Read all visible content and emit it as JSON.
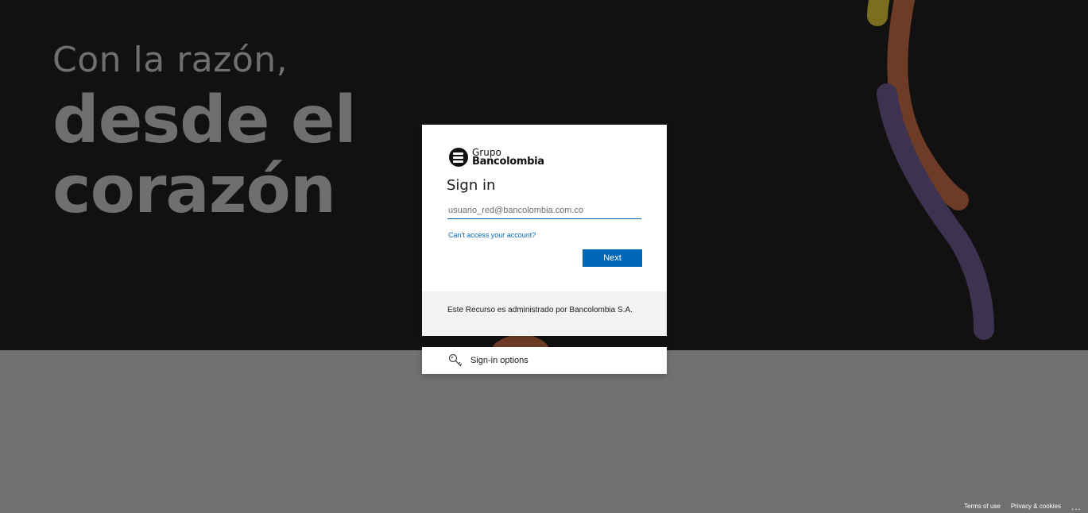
{
  "background": {
    "tagline_line1": "Con la razón,",
    "tagline_line2": "desde el",
    "tagline_line3": "corazón"
  },
  "card": {
    "logo_line1": "Grupo",
    "logo_line2": "Bancolombia",
    "title": "Sign in",
    "email_placeholder": "usuario_red@bancolombia.com.co",
    "cant_access_link": "Can't access your account?",
    "next_button": "Next",
    "footer_text": "Este Recurso es administrado por Bancolombia S.A."
  },
  "sign_in_options": {
    "icon": "key-icon",
    "label": "Sign-in options"
  },
  "footer": {
    "terms": "Terms of use",
    "privacy": "Privacy & cookies",
    "more": "..."
  },
  "colors": {
    "accent": "#0067b8",
    "hero_bg": "#111111",
    "page_bg": "#707070",
    "tagline": "#6f6f6f",
    "decor_olive": "#7b6e1e",
    "decor_brown": "#6e3b27",
    "decor_purple": "#3d3250"
  }
}
